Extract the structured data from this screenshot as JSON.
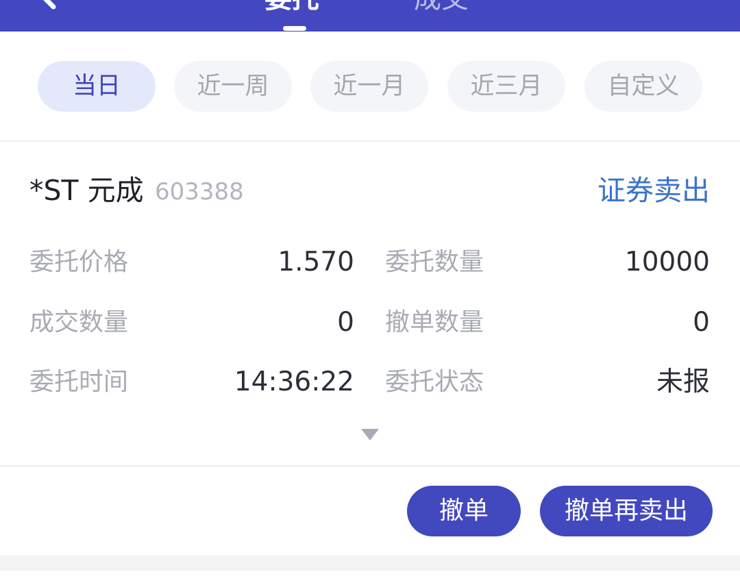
{
  "header": {
    "tabs": [
      {
        "label": "委托"
      },
      {
        "label": "成交"
      }
    ]
  },
  "filters": [
    {
      "label": "当日"
    },
    {
      "label": "近一周"
    },
    {
      "label": "近一月"
    },
    {
      "label": "近三月"
    },
    {
      "label": "自定义"
    }
  ],
  "order": {
    "name": "*ST 元成",
    "code": "603388",
    "type": "证券卖出",
    "fields": {
      "price_label": "委托价格",
      "price_value": "1.570",
      "quantity_label": "委托数量",
      "quantity_value": "10000",
      "filled_label": "成交数量",
      "filled_value": "0",
      "cancelled_label": "撤单数量",
      "cancelled_value": "0",
      "time_label": "委托时间",
      "time_value": "14:36:22",
      "status_label": "委托状态",
      "status_value": "未报"
    }
  },
  "actions": {
    "cancel_label": "撤单",
    "cancel_resell_label": "撤单再卖出"
  },
  "icons": {
    "back": "back-chevron-icon",
    "expand": "triangle-down-icon"
  },
  "colors": {
    "brand": "#4348c0",
    "accent_text": "#3b73c9",
    "chip_active_bg": "#e4e8fb"
  }
}
